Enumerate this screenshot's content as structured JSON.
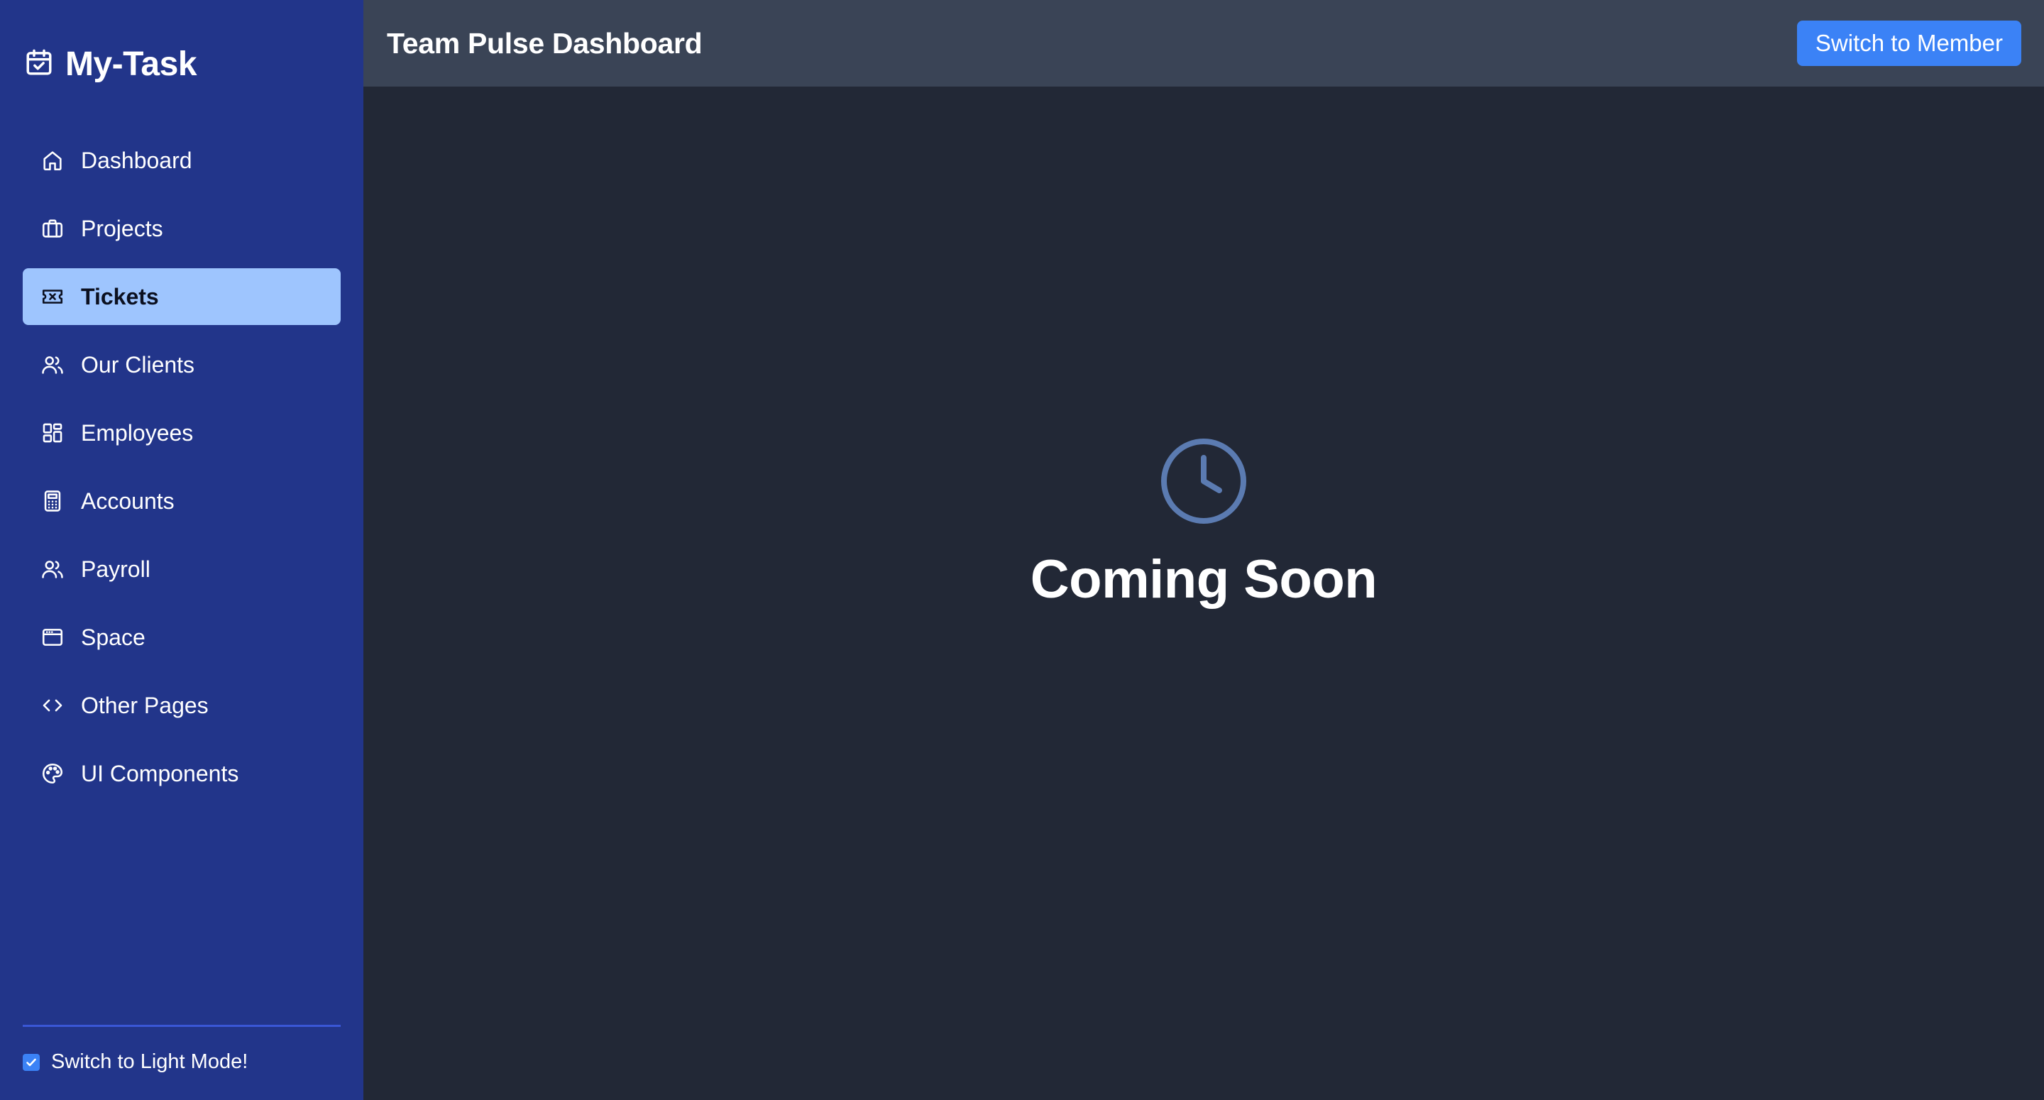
{
  "brand": {
    "name": "My-Task",
    "icon": "calendar-check-icon"
  },
  "sidebar": {
    "items": [
      {
        "label": "Dashboard",
        "icon": "home-icon",
        "active": false
      },
      {
        "label": "Projects",
        "icon": "briefcase-icon",
        "active": false
      },
      {
        "label": "Tickets",
        "icon": "ticket-icon",
        "active": true
      },
      {
        "label": "Our Clients",
        "icon": "users-icon",
        "active": false
      },
      {
        "label": "Employees",
        "icon": "grid-icon",
        "active": false
      },
      {
        "label": "Accounts",
        "icon": "calculator-icon",
        "active": false
      },
      {
        "label": "Payroll",
        "icon": "users-icon",
        "active": false
      },
      {
        "label": "Space",
        "icon": "browser-window-icon",
        "active": false
      },
      {
        "label": "Other Pages",
        "icon": "code-icon",
        "active": false
      },
      {
        "label": "UI Components",
        "icon": "palette-icon",
        "active": false
      }
    ],
    "theme_toggle": {
      "label": "Switch to Light Mode!",
      "checked": true
    }
  },
  "header": {
    "title": "Team Pulse Dashboard",
    "switch_button": "Switch to Member"
  },
  "main": {
    "status_icon": "clock-icon",
    "message": "Coming Soon"
  },
  "colors": {
    "sidebar_bg": "#22358a",
    "active_item_bg": "#9ec5fe",
    "header_bg": "#3a4456",
    "content_bg": "#222836",
    "accent": "#3b82f6",
    "clock_icon": "#5b7bb1"
  }
}
